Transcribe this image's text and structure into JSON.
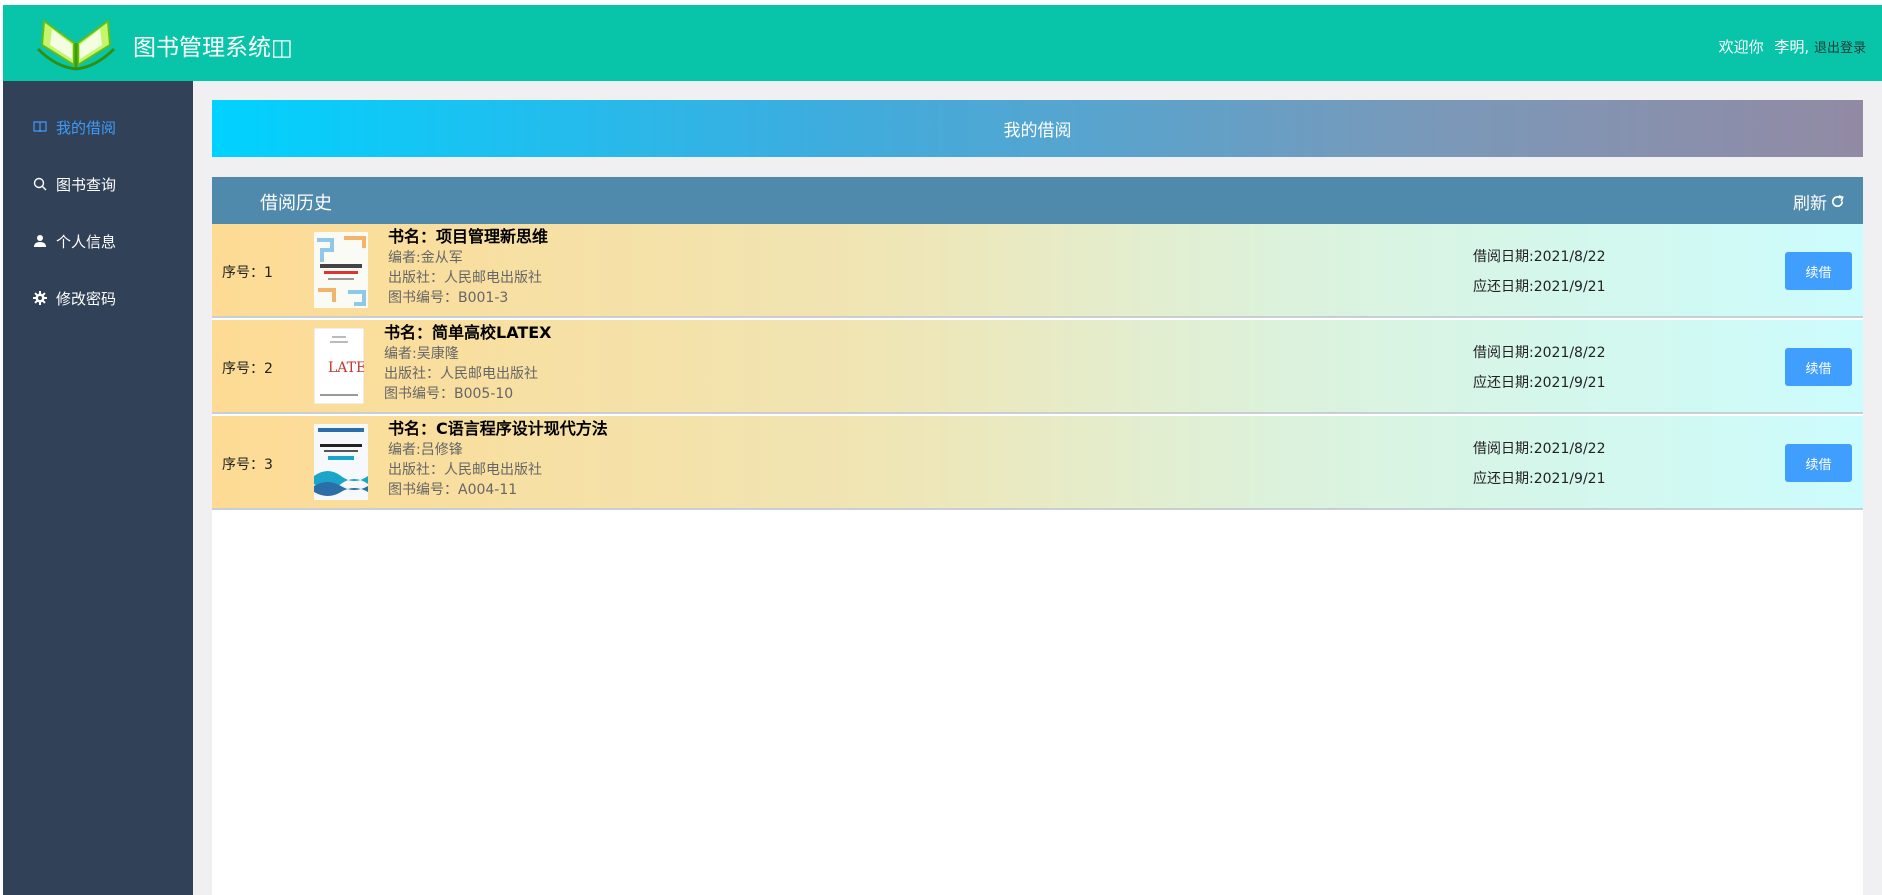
{
  "header": {
    "title": "图书管理系统◫",
    "welcome": "欢迎你",
    "username": "李明,",
    "logout": "退出登录"
  },
  "sidebar": {
    "items": [
      {
        "label": "我的借阅",
        "icon": "book-icon",
        "active": true
      },
      {
        "label": "图书查询",
        "icon": "search-icon",
        "active": false
      },
      {
        "label": "个人信息",
        "icon": "user-icon",
        "active": false
      },
      {
        "label": "修改密码",
        "icon": "gear-icon",
        "active": false
      }
    ]
  },
  "main": {
    "banner": "我的借阅",
    "panel_title": "借阅历史",
    "refresh_label": "刷新",
    "records": [
      {
        "seq": "序号：1",
        "book_name": "书名：项目管理新思维",
        "author": "编者:金从军",
        "publisher": "出版社：人民邮电出版社",
        "book_id": "图书编号：B001-3",
        "borrow_date": "借阅日期:2021/8/22",
        "due_date": "应还日期:2021/9/21",
        "renew_label": "续借"
      },
      {
        "seq": "序号：2",
        "book_name": "书名：简单高校LATEX",
        "author": "编者:吴康隆",
        "publisher": "出版社：人民邮电出版社",
        "book_id": "图书编号：B005-10",
        "borrow_date": "借阅日期:2021/8/22",
        "due_date": "应还日期:2021/9/21",
        "renew_label": "续借"
      },
      {
        "seq": "序号：3",
        "book_name": "书名：C语言程序设计现代方法",
        "author": "编者:吕修锋",
        "publisher": "出版社：人民邮电出版社",
        "book_id": "图书编号：A004-11",
        "borrow_date": "借阅日期:2021/8/22",
        "due_date": "应还日期:2021/9/21",
        "renew_label": "续借"
      }
    ]
  },
  "colors": {
    "header_bg": "#08c5a9",
    "sidebar_bg": "#314157",
    "active_menu": "#3f9bf7",
    "panel_header_bg": "#4f89ab",
    "button_bg": "#409eff"
  }
}
